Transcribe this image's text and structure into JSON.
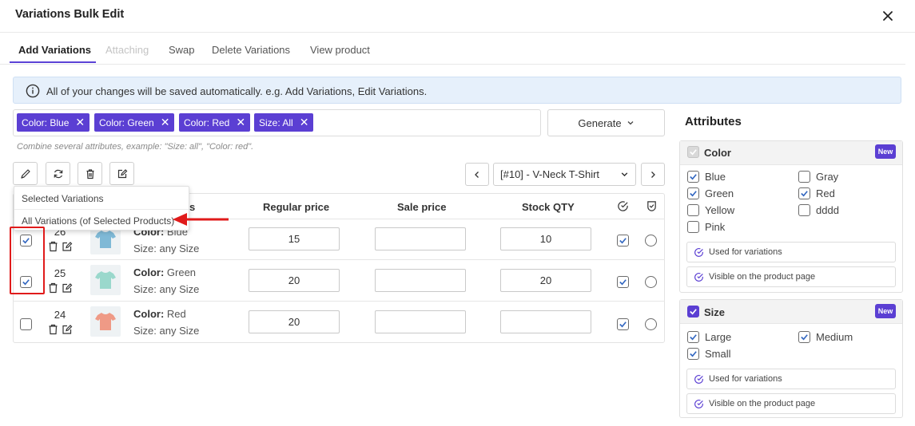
{
  "modal": {
    "title": "Variations Bulk Edit"
  },
  "tabs": [
    {
      "label": "Add Variations"
    },
    {
      "label": "Attaching"
    },
    {
      "label": "Swap"
    },
    {
      "label": "Delete Variations"
    },
    {
      "label": "View product"
    }
  ],
  "notice": {
    "text": "All of your changes will be saved automatically. e.g. Add Variations, Edit Variations."
  },
  "tags": [
    {
      "label": "Color: Blue"
    },
    {
      "label": "Color: Green"
    },
    {
      "label": "Color: Red"
    },
    {
      "label": "Size: All"
    }
  ],
  "tag_remove_symbol": "✕",
  "hint": "Combine several attributes, example: \"Size: all\", \"Color: red\".",
  "generate_label": "Generate",
  "product_select": {
    "value": "[#10] - V-Neck T-Shirt"
  },
  "dropdown": {
    "items": [
      {
        "label": "Selected Variations"
      },
      {
        "label": "All Variations (of Selected Products)"
      }
    ]
  },
  "table": {
    "columns": {
      "variations_partial": "ns",
      "regular_price": "Regular price",
      "sale_price": "Sale price",
      "stock_qty": "Stock QTY"
    },
    "rows": [
      {
        "id": "26",
        "color_label": "Color:",
        "color": "Blue",
        "size": "Size: any Size",
        "regular_price": "15",
        "sale_price": "",
        "stock": "10",
        "selected": true,
        "enabled": true,
        "tshirt_color": "#7fb9d6"
      },
      {
        "id": "25",
        "color_label": "Color:",
        "color": "Green",
        "size": "Size: any Size",
        "regular_price": "20",
        "sale_price": "",
        "stock": "20",
        "selected": true,
        "enabled": true,
        "tshirt_color": "#9ad8cc"
      },
      {
        "id": "24",
        "color_label": "Color:",
        "color": "Red",
        "size": "Size: any Size",
        "regular_price": "20",
        "sale_price": "",
        "stock": "",
        "selected": false,
        "enabled": true,
        "tshirt_color": "#ef9a86"
      }
    ]
  },
  "attributes": {
    "title": "Attributes",
    "color": {
      "title": "Color",
      "badge": "New",
      "options": [
        {
          "label": "Blue",
          "checked": true
        },
        {
          "label": "Gray",
          "checked": false
        },
        {
          "label": "Green",
          "checked": true
        },
        {
          "label": "Red",
          "checked": true
        },
        {
          "label": "Yellow",
          "checked": false
        },
        {
          "label": "dddd",
          "checked": false
        },
        {
          "label": "Pink",
          "checked": false
        }
      ],
      "used_label": "Used for variations",
      "visible_label": "Visible on the product page"
    },
    "size": {
      "title": "Size",
      "badge": "New",
      "options": [
        {
          "label": "Large",
          "checked": true
        },
        {
          "label": "Medium",
          "checked": true
        },
        {
          "label": "Small",
          "checked": true
        }
      ],
      "used_label": "Used for variations",
      "visible_label": "Visible on the product page"
    }
  },
  "colors": {
    "accent": "#5b3fd3",
    "annotation_red": "#e01b1b",
    "notice_bg": "#e6f0fb"
  }
}
